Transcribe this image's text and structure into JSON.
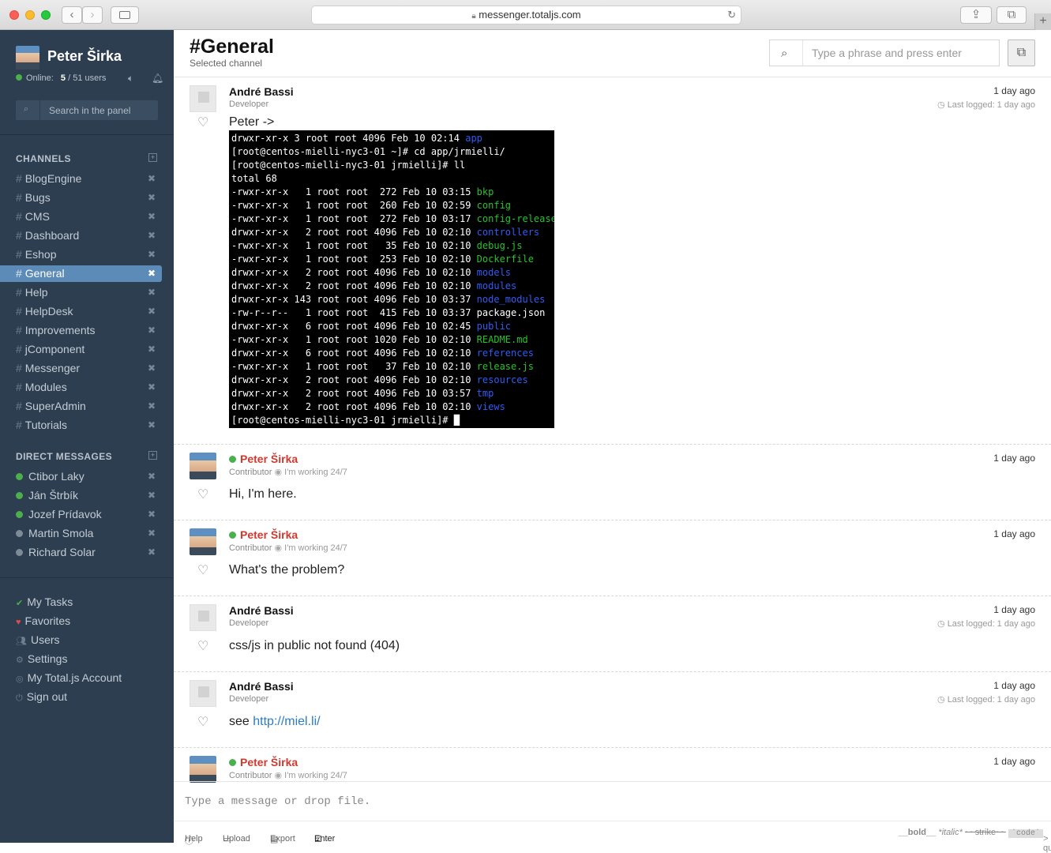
{
  "browser": {
    "url": "messenger.totaljs.com"
  },
  "user": {
    "name": "Peter Širka",
    "online_label": "Online:",
    "online_count": "5",
    "online_total": "/ 51 users"
  },
  "search_panel": {
    "placeholder": "Search in the panel"
  },
  "channels": {
    "title": "CHANNELS",
    "items": [
      {
        "label": "BlogEngine"
      },
      {
        "label": "Bugs"
      },
      {
        "label": "CMS"
      },
      {
        "label": "Dashboard"
      },
      {
        "label": "Eshop"
      },
      {
        "label": "General",
        "active": true
      },
      {
        "label": "Help"
      },
      {
        "label": "HelpDesk"
      },
      {
        "label": "Improvements"
      },
      {
        "label": "jComponent"
      },
      {
        "label": "Messenger"
      },
      {
        "label": "Modules"
      },
      {
        "label": "SuperAdmin"
      },
      {
        "label": "Tutorials"
      }
    ]
  },
  "direct": {
    "title": "DIRECT MESSAGES",
    "items": [
      {
        "label": "Ctibor Laky",
        "status": "#4cae4c"
      },
      {
        "label": "Ján Štrbík",
        "status": "#4cae4c"
      },
      {
        "label": "Jozef Prídavok",
        "status": "#4cae4c"
      },
      {
        "label": "Martin Smola",
        "status": "#7d8a97"
      },
      {
        "label": "Richard Solar",
        "status": "#7d8a97"
      }
    ]
  },
  "menu": [
    {
      "label": "My Tasks",
      "icon": "check-circle-icon"
    },
    {
      "label": "Favorites",
      "icon": "heart-icon"
    },
    {
      "label": "Users",
      "icon": "users-icon"
    },
    {
      "label": "Settings",
      "icon": "gear-icon"
    },
    {
      "label": "My Total.js Account",
      "icon": "account-icon"
    },
    {
      "label": "Sign out",
      "icon": "power-icon"
    }
  ],
  "header": {
    "title": "#General",
    "subtitle": "Selected channel",
    "search_placeholder": "Type a phrase and press enter"
  },
  "messages": [
    {
      "name": "André Bassi",
      "role": "Developer",
      "time": "1 day ago",
      "logged": "Last logged: 1 day ago",
      "text": "Peter ->"
    },
    {
      "name": "Peter Širka",
      "role": "Contributor",
      "status": "I'm working 24/7",
      "time": "1 day ago",
      "text": "Hi, I'm here."
    },
    {
      "name": "Peter Širka",
      "role": "Contributor",
      "status": "I'm working 24/7",
      "time": "1 day ago",
      "text": "What's the problem?"
    },
    {
      "name": "André Bassi",
      "role": "Developer",
      "time": "1 day ago",
      "logged": "Last logged: 1 day ago",
      "text": "css/js in public not found (404)"
    },
    {
      "name": "André Bassi",
      "role": "Developer",
      "time": "1 day ago",
      "logged": "Last logged: 1 day ago",
      "text": "see ",
      "link": "http://miel.li/"
    },
    {
      "name": "Peter Širka",
      "role": "Contributor",
      "status": "I'm working 24/7",
      "time": "1 day ago"
    }
  ],
  "terminal": [
    {
      "a": "drwxr-xr-x 3 root root 4096 Feb 10 02:14 ",
      "b": "app",
      "c": "blue"
    },
    {
      "a": "[root@centos-mielli-nyc3-01 ~]# cd app/jrmielli/",
      "b": "",
      "c": ""
    },
    {
      "a": "[root@centos-mielli-nyc3-01 jrmielli]# ll",
      "b": "",
      "c": ""
    },
    {
      "a": "total 68",
      "b": "",
      "c": ""
    },
    {
      "a": "-rwxr-xr-x   1 root root  272 Feb 10 03:15 ",
      "b": "bkp",
      "c": "green"
    },
    {
      "a": "-rwxr-xr-x   1 root root  260 Feb 10 02:59 ",
      "b": "config",
      "c": "green"
    },
    {
      "a": "-rwxr-xr-x   1 root root  272 Feb 10 03:17 ",
      "b": "config-release",
      "c": "green"
    },
    {
      "a": "drwxr-xr-x   2 root root 4096 Feb 10 02:10 ",
      "b": "controllers",
      "c": "blue"
    },
    {
      "a": "-rwxr-xr-x   1 root root   35 Feb 10 02:10 ",
      "b": "debug.js",
      "c": "green"
    },
    {
      "a": "-rwxr-xr-x   1 root root  253 Feb 10 02:10 ",
      "b": "Dockerfile",
      "c": "green"
    },
    {
      "a": "drwxr-xr-x   2 root root 4096 Feb 10 02:10 ",
      "b": "models",
      "c": "blue"
    },
    {
      "a": "drwxr-xr-x   2 root root 4096 Feb 10 02:10 ",
      "b": "modules",
      "c": "blue"
    },
    {
      "a": "drwxr-xr-x 143 root root 4096 Feb 10 03:37 ",
      "b": "node_modules",
      "c": "blue"
    },
    {
      "a": "-rw-r--r--   1 root root  415 Feb 10 03:37 ",
      "b": "package.json",
      "c": ""
    },
    {
      "a": "drwxr-xr-x   6 root root 4096 Feb 10 02:45 ",
      "b": "public",
      "c": "blue"
    },
    {
      "a": "-rwxr-xr-x   1 root root 1020 Feb 10 02:10 ",
      "b": "README.md",
      "c": "green"
    },
    {
      "a": "drwxr-xr-x   6 root root 4096 Feb 10 02:10 ",
      "b": "references",
      "c": "blue"
    },
    {
      "a": "-rwxr-xr-x   1 root root   37 Feb 10 02:10 ",
      "b": "release.js",
      "c": "green"
    },
    {
      "a": "drwxr-xr-x   2 root root 4096 Feb 10 02:10 ",
      "b": "resources",
      "c": "blue"
    },
    {
      "a": "drwxr-xr-x   2 root root 4096 Feb 10 03:57 ",
      "b": "tmp",
      "c": "blue"
    },
    {
      "a": "drwxr-xr-x   2 root root 4096 Feb 10 02:10 ",
      "b": "views",
      "c": "blue"
    },
    {
      "a": "[root@centos-mielli-nyc3-01 jrmielli]# ",
      "b": "█",
      "c": ""
    }
  ],
  "composer": {
    "placeholder": "Type a message or drop file."
  },
  "footer": {
    "help": "Help",
    "upload": "Upload",
    "export": "Export",
    "enter": "Enter",
    "bold": "__bold__",
    "italic": "*italic*",
    "strike": "~~strike~~",
    "code": "`code`",
    "quote": "> quote"
  }
}
